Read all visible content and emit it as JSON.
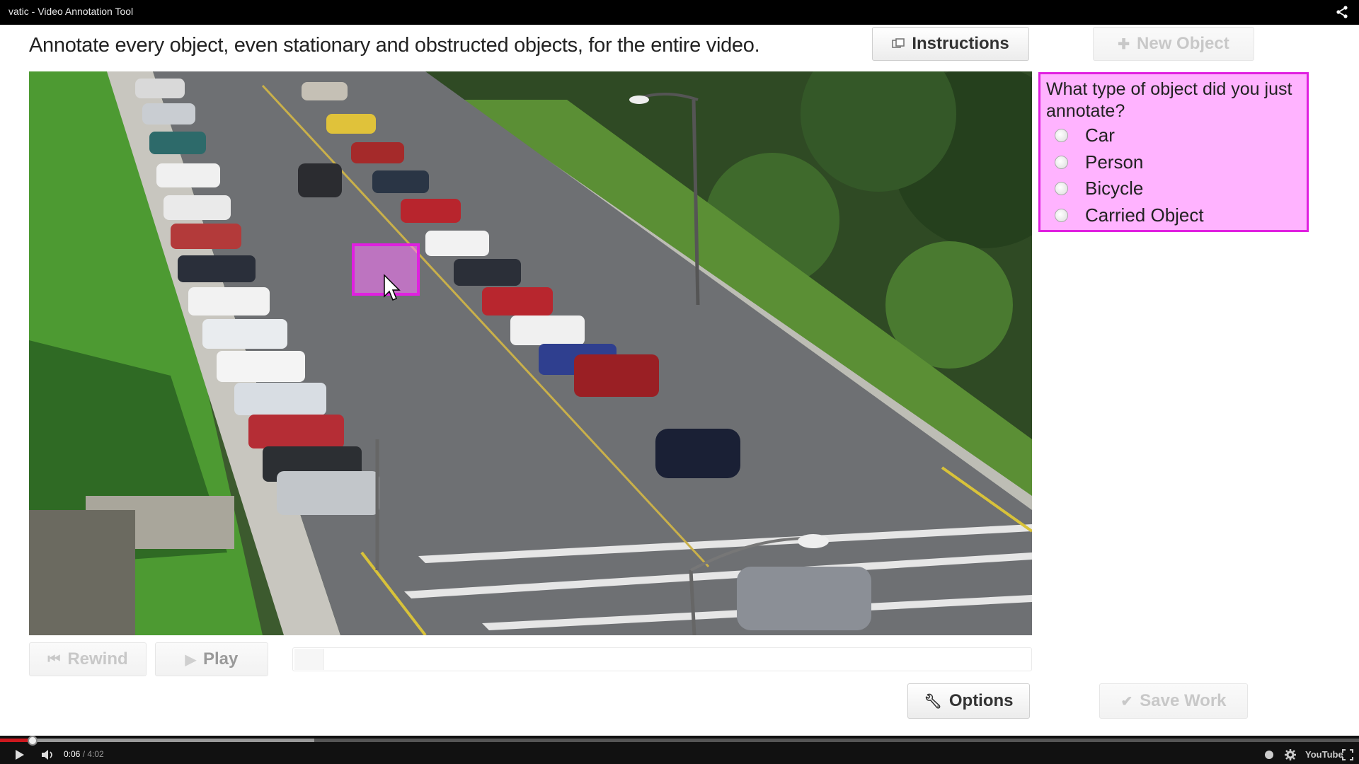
{
  "window": {
    "title": "vatic - Video Annotation Tool"
  },
  "header": {
    "instruction_text": "Annotate every object, even stationary and obstructed objects, for the entire video.",
    "instructions_button": "Instructions",
    "new_object_button": "New Object"
  },
  "question": {
    "prompt": "What type of object did you just annotate?",
    "options": [
      "Car",
      "Person",
      "Bicycle",
      "Carried Object"
    ]
  },
  "controls": {
    "rewind_label": "Rewind",
    "play_label": "Play",
    "options_label": "Options",
    "save_label": "Save Work"
  },
  "player": {
    "current_time": "0:06",
    "separator": " / ",
    "duration": "4:02",
    "played_fraction": 0.024,
    "loaded_fraction": 0.231,
    "logo_text": "YouTube"
  },
  "colors": {
    "question_bg": "#ffb3ff",
    "question_border": "#e020e0",
    "annotation_box": "#e020e0",
    "progress_played": "#cc181e"
  },
  "icons": [
    "share-icon",
    "instructions-icon",
    "plus-icon",
    "rewind-icon",
    "play-icon",
    "wrench-icon",
    "check-icon",
    "yt-play-icon",
    "volume-icon",
    "annotations-icon",
    "settings-icon",
    "fullscreen-icon"
  ]
}
